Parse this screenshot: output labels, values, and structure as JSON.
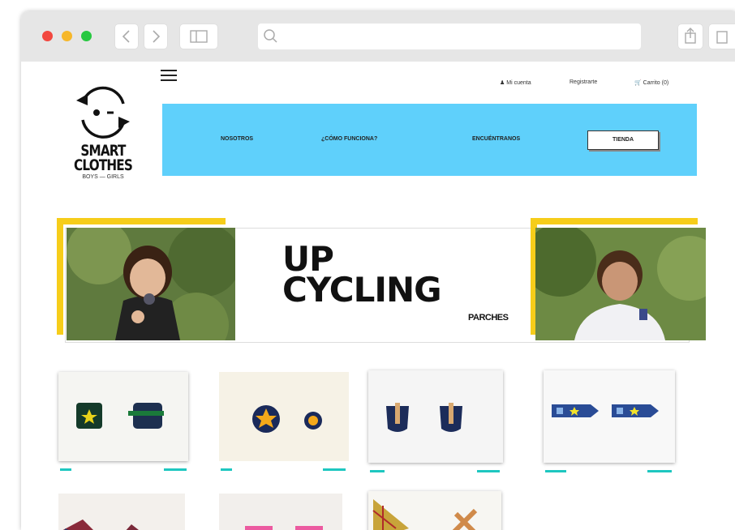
{
  "top_links": {
    "account": "Mi cuenta",
    "register": "Registrarte",
    "cart": "Carrito (0)"
  },
  "logo": {
    "line1": "SMART",
    "line2": "CLOTHES",
    "tagline": "BOYS — GIRLS"
  },
  "nav": {
    "nosotros": "NOSOTROS",
    "como": "¿CÓMO FUNCIONA?",
    "encuentranos": "ENCUÉNTRANOS",
    "tienda": "TIENDA"
  },
  "hero": {
    "line1": "UP",
    "line2": "CYCLING",
    "sub": "PARCHES"
  },
  "colors": {
    "accent_blue": "#5fd0fb",
    "accent_yellow": "#f6cd1a",
    "tag_teal": "#1ec7c0"
  }
}
